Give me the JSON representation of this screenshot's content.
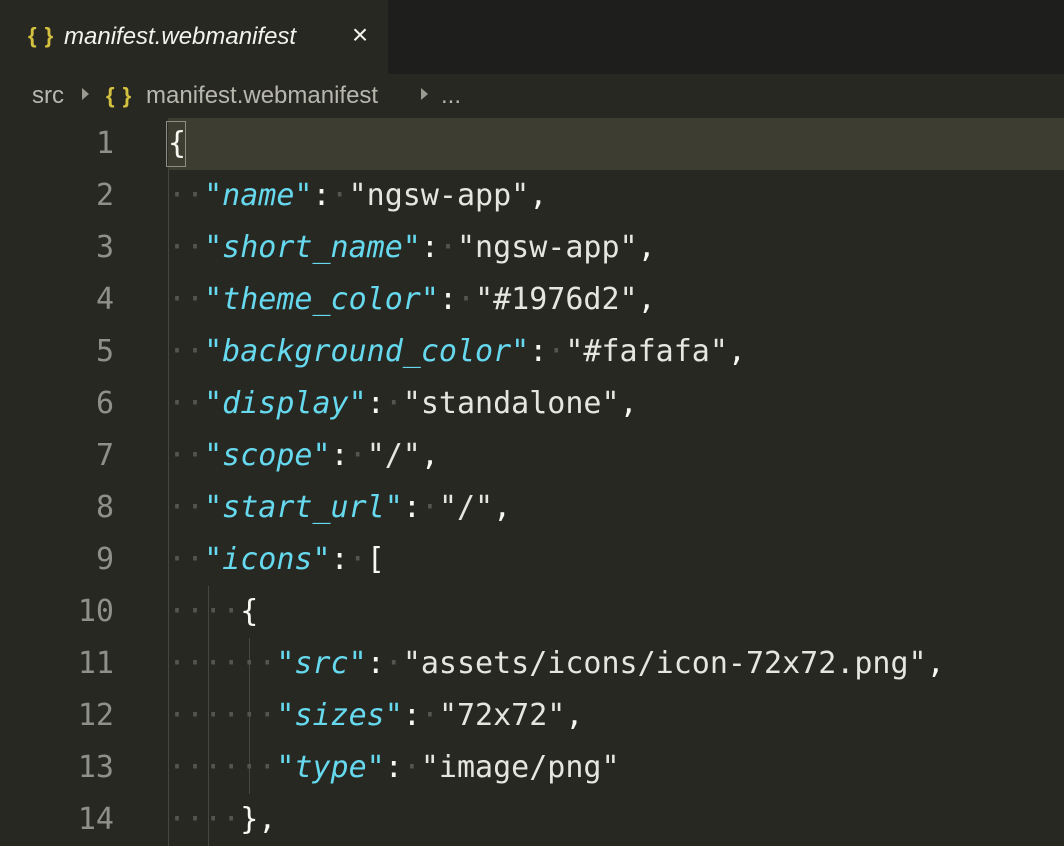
{
  "tab": {
    "icon": "{ }",
    "icon_name": "json-braces-icon",
    "label": "manifest.webmanifest",
    "close": "×"
  },
  "breadcrumb": {
    "folder": "src",
    "file_icon": "{ }",
    "file": "manifest.webmanifest",
    "more": "..."
  },
  "colors": {
    "background": "#272822",
    "key": "#66d9ef",
    "string": "#e6e6e0",
    "line_number": "#90908a",
    "icon_accent": "#d4c13f"
  },
  "lines": [
    {
      "n": "1",
      "dots": "",
      "parts": [
        {
          "t": "{",
          "c": "pun"
        }
      ]
    },
    {
      "n": "2",
      "dots": "··",
      "parts": [
        {
          "t": "\"name\"",
          "c": "key"
        },
        {
          "t": ":",
          "c": "pun"
        },
        {
          "t": "·",
          "c": "dots"
        },
        {
          "t": "\"ngsw-app\"",
          "c": "str"
        },
        {
          "t": ",",
          "c": "pun"
        }
      ]
    },
    {
      "n": "3",
      "dots": "··",
      "parts": [
        {
          "t": "\"short_name\"",
          "c": "key"
        },
        {
          "t": ":",
          "c": "pun"
        },
        {
          "t": "·",
          "c": "dots"
        },
        {
          "t": "\"ngsw-app\"",
          "c": "str"
        },
        {
          "t": ",",
          "c": "pun"
        }
      ]
    },
    {
      "n": "4",
      "dots": "··",
      "parts": [
        {
          "t": "\"theme_color\"",
          "c": "key"
        },
        {
          "t": ":",
          "c": "pun"
        },
        {
          "t": "·",
          "c": "dots"
        },
        {
          "t": "\"#1976d2\"",
          "c": "str"
        },
        {
          "t": ",",
          "c": "pun"
        }
      ]
    },
    {
      "n": "5",
      "dots": "··",
      "parts": [
        {
          "t": "\"background_color\"",
          "c": "key"
        },
        {
          "t": ":",
          "c": "pun"
        },
        {
          "t": "·",
          "c": "dots"
        },
        {
          "t": "\"#fafafa\"",
          "c": "str"
        },
        {
          "t": ",",
          "c": "pun"
        }
      ]
    },
    {
      "n": "6",
      "dots": "··",
      "parts": [
        {
          "t": "\"display\"",
          "c": "key"
        },
        {
          "t": ":",
          "c": "pun"
        },
        {
          "t": "·",
          "c": "dots"
        },
        {
          "t": "\"standalone\"",
          "c": "str"
        },
        {
          "t": ",",
          "c": "pun"
        }
      ]
    },
    {
      "n": "7",
      "dots": "··",
      "parts": [
        {
          "t": "\"scope\"",
          "c": "key"
        },
        {
          "t": ":",
          "c": "pun"
        },
        {
          "t": "·",
          "c": "dots"
        },
        {
          "t": "\"/\"",
          "c": "str"
        },
        {
          "t": ",",
          "c": "pun"
        }
      ]
    },
    {
      "n": "8",
      "dots": "··",
      "parts": [
        {
          "t": "\"start_url\"",
          "c": "key"
        },
        {
          "t": ":",
          "c": "pun"
        },
        {
          "t": "·",
          "c": "dots"
        },
        {
          "t": "\"/\"",
          "c": "str"
        },
        {
          "t": ",",
          "c": "pun"
        }
      ]
    },
    {
      "n": "9",
      "dots": "··",
      "parts": [
        {
          "t": "\"icons\"",
          "c": "key"
        },
        {
          "t": ":",
          "c": "pun"
        },
        {
          "t": "·",
          "c": "dots"
        },
        {
          "t": "[",
          "c": "pun"
        }
      ]
    },
    {
      "n": "10",
      "dots": "····",
      "parts": [
        {
          "t": "{",
          "c": "pun"
        }
      ]
    },
    {
      "n": "11",
      "dots": "······",
      "parts": [
        {
          "t": "\"src\"",
          "c": "key"
        },
        {
          "t": ":",
          "c": "pun"
        },
        {
          "t": "·",
          "c": "dots"
        },
        {
          "t": "\"assets/icons/icon-72x72.png\"",
          "c": "str"
        },
        {
          "t": ",",
          "c": "pun"
        }
      ]
    },
    {
      "n": "12",
      "dots": "······",
      "parts": [
        {
          "t": "\"sizes\"",
          "c": "key"
        },
        {
          "t": ":",
          "c": "pun"
        },
        {
          "t": "·",
          "c": "dots"
        },
        {
          "t": "\"72x72\"",
          "c": "str"
        },
        {
          "t": ",",
          "c": "pun"
        }
      ]
    },
    {
      "n": "13",
      "dots": "······",
      "parts": [
        {
          "t": "\"type\"",
          "c": "key"
        },
        {
          "t": ":",
          "c": "pun"
        },
        {
          "t": "·",
          "c": "dots"
        },
        {
          "t": "\"image/png\"",
          "c": "str"
        }
      ]
    },
    {
      "n": "14",
      "dots": "····",
      "parts": [
        {
          "t": "},",
          "c": "pun"
        }
      ]
    }
  ]
}
